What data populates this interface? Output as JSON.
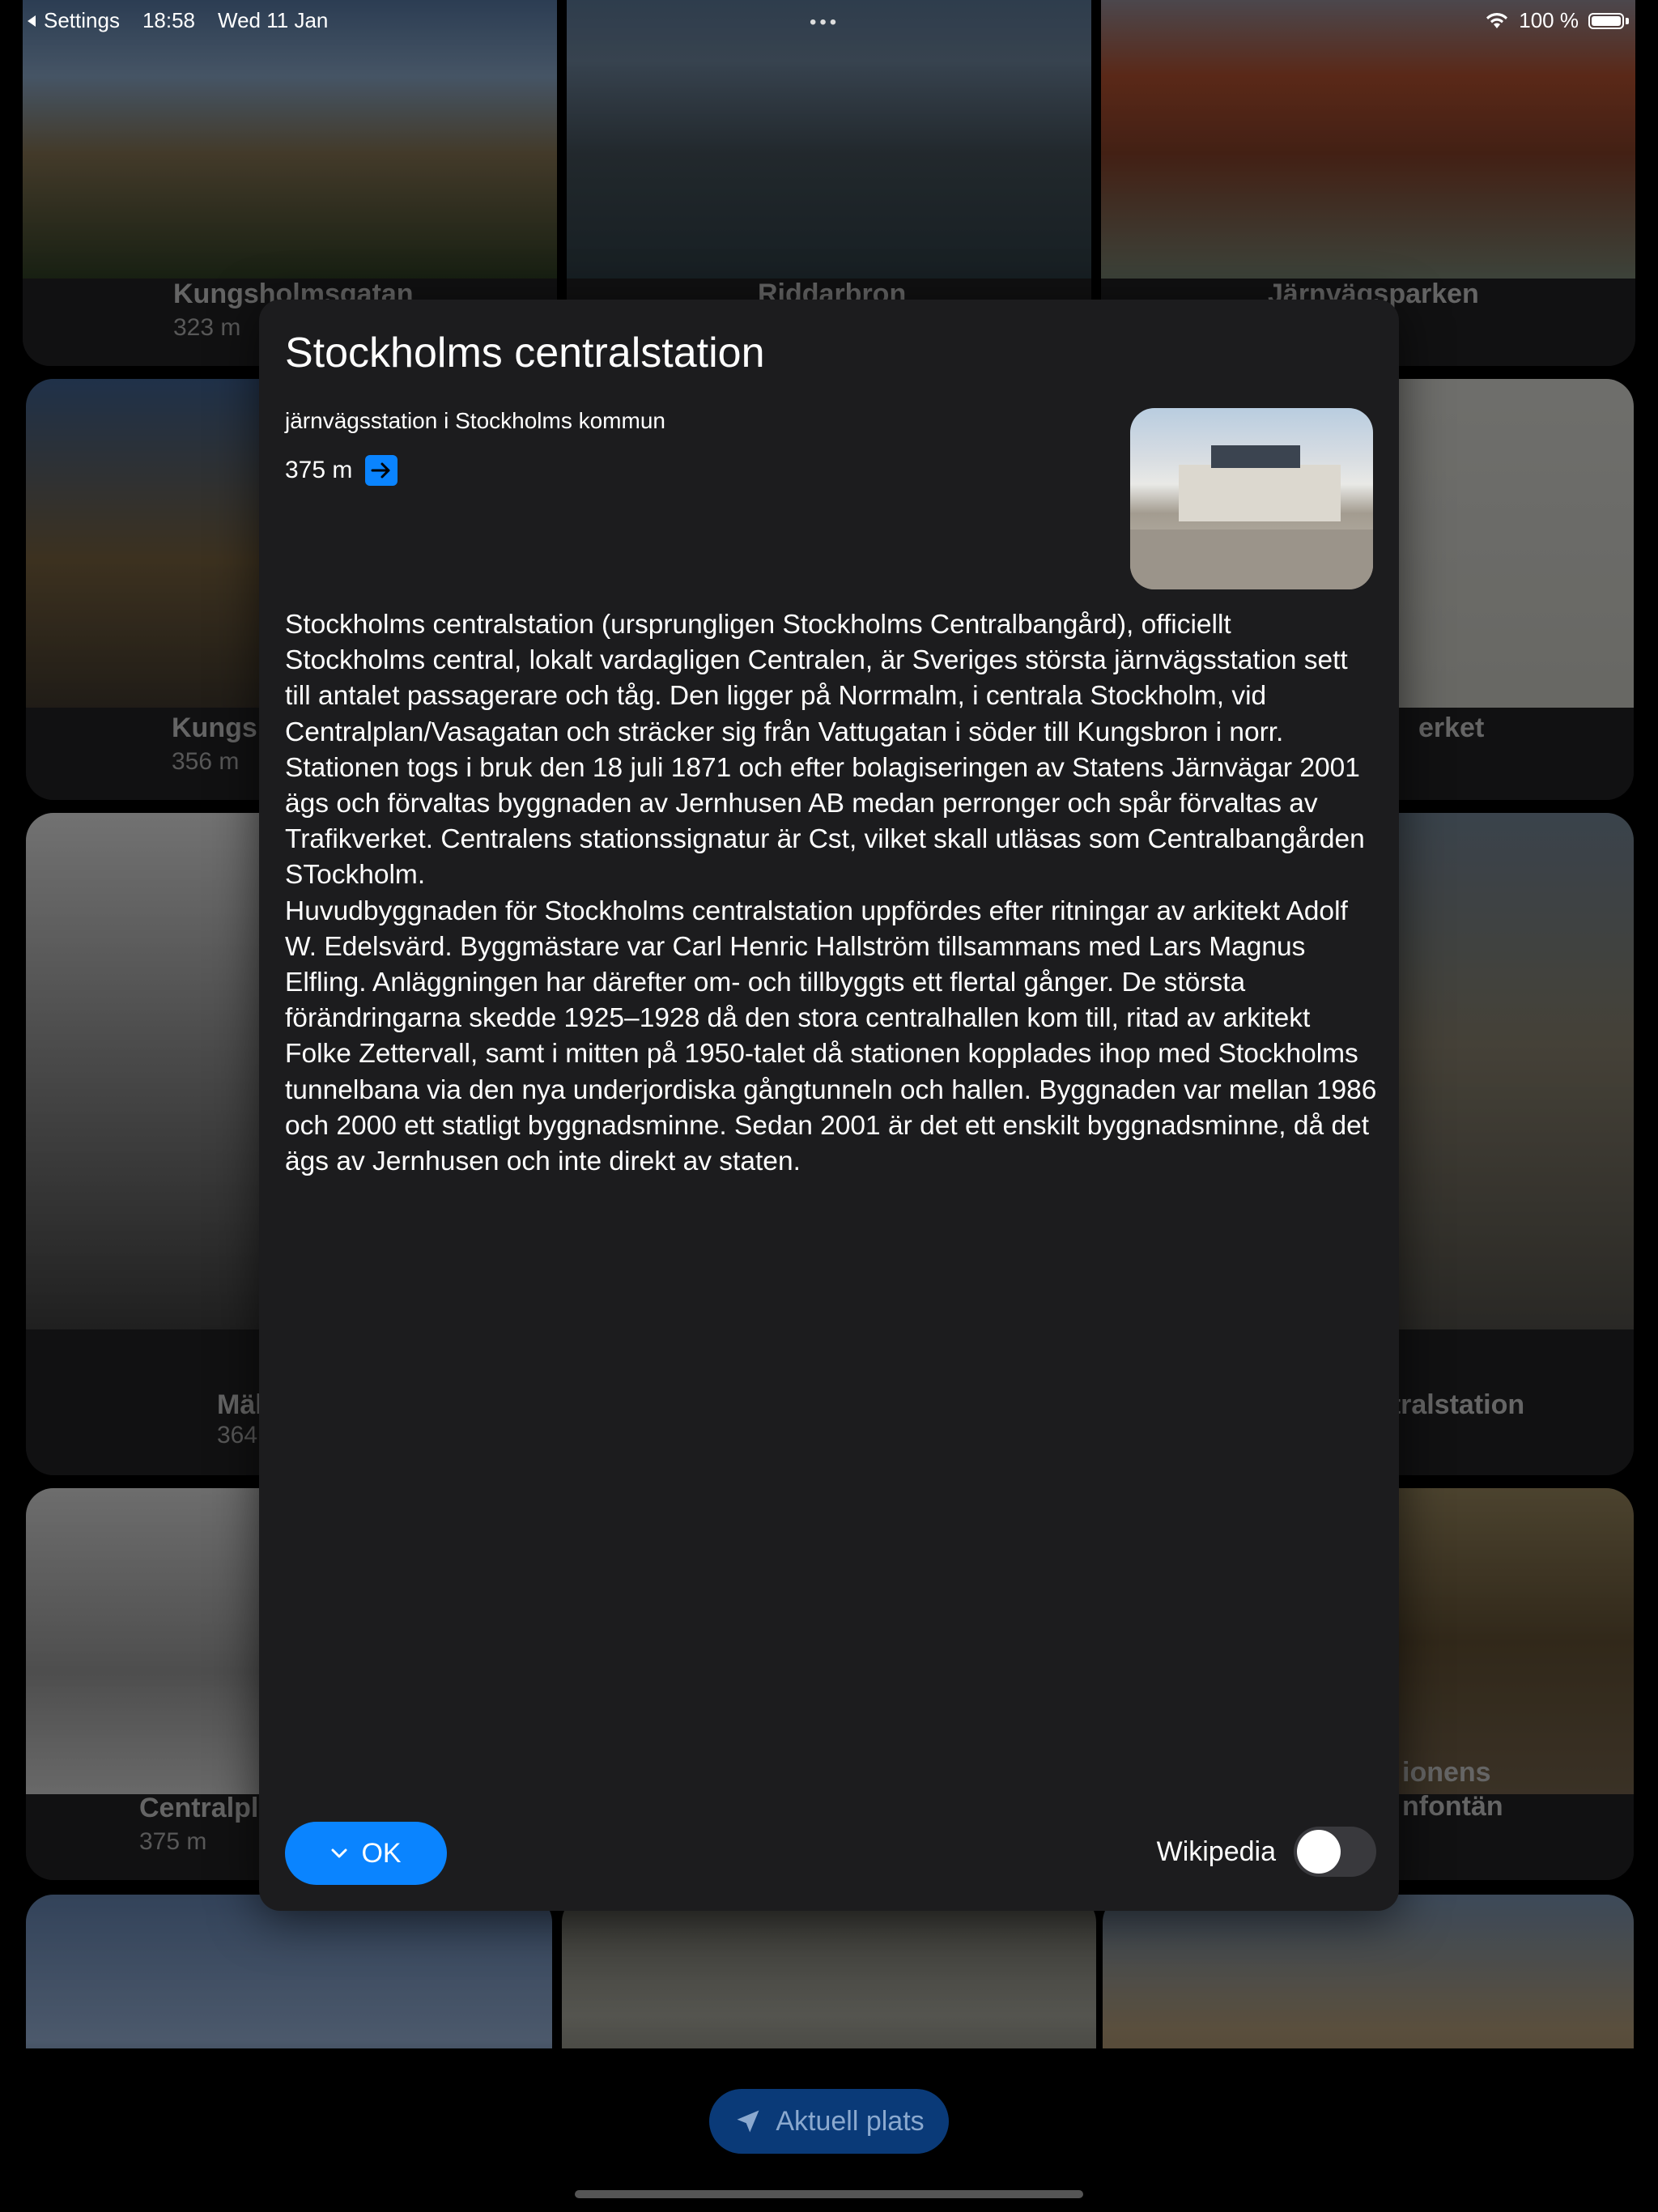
{
  "statusbar": {
    "back_label": "Settings",
    "time": "18:58",
    "date": "Wed 11 Jan",
    "battery": "100 %"
  },
  "cards": [
    {
      "name": "Kungsholmsgatan",
      "distance": "323 m"
    },
    {
      "name": "Riddarbron",
      "distance": ""
    },
    {
      "name": "Järnvägsparken",
      "distance": ""
    },
    {
      "name": "Kungsh",
      "distance": "356 m"
    },
    {
      "name": "erket",
      "distance": ""
    },
    {
      "name": "Mäl",
      "distance": "364"
    },
    {
      "name": "ntralstation",
      "distance": ""
    },
    {
      "name": "Centralpla",
      "distance": "375 m"
    },
    {
      "name": "ionens\nnfontän",
      "distance": ""
    }
  ],
  "fab": {
    "label": "Aktuell plats",
    "icon": "location-arrow-icon"
  },
  "modal": {
    "title": "Stockholms centralstation",
    "subtitle": "järnvägsstation i Stockholms kommun",
    "distance": "375 m",
    "body": "Stockholms centralstation (ursprungligen Stockholms Centralbangård), officiellt Stockholms central, lokalt vardagligen Centralen, är Sveriges största järnvägsstation sett till antalet passagerare och tåg. Den ligger på Norrmalm, i centrala Stockholm, vid Centralplan/Vasagatan och sträcker sig från Vattugatan i söder till Kungsbron i norr. Stationen togs i bruk den 18 juli 1871 och efter bolagiseringen av Statens Järnvägar 2001 ägs och förvaltas byggnaden av Jernhusen AB medan perronger och spår förvaltas av Trafikverket. Centralens stationssignatur är Cst, vilket skall utläsas som Centralbangården STockholm.\nHuvudbyggnaden för Stockholms centralstation uppfördes efter ritningar av arkitekt Adolf W. Edelsvärd. Byggmästare var Carl Henric Hallström tillsammans med Lars Magnus Elfling. Anläggningen har därefter om- och tillbyggts ett flertal gånger. De största förändringarna skedde 1925–1928 då den stora centralhallen kom till, ritad av arkitekt Folke Zettervall, samt i mitten på 1950-talet då stationen kopplades ihop med Stockholms tunnelbana via den nya underjordiska gångtunneln och hallen. Byggnaden var mellan 1986 och 2000 ett statligt byggnadsminne. Sedan 2001 är det ett enskilt byggnadsminne, då det ägs av Jernhusen och inte direkt av staten.",
    "ok_label": "OK",
    "wikipedia_label": "Wikipedia",
    "wikipedia_on": false,
    "accent": "#0a84ff"
  }
}
